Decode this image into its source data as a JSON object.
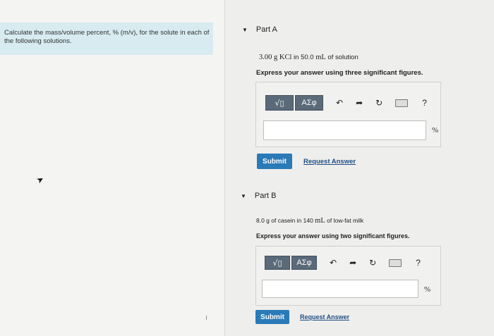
{
  "prompt": "Calculate the mass/volume percent, % (m/v), for the solute in each of the following solutions.",
  "toolbar": {
    "template_icon_label": "√▯",
    "greek_label": "ΑΣφ",
    "undo_icon": "undo-arrow-icon",
    "redo_icon": "redo-arrow-icon",
    "reset_icon": "reset-icon",
    "keyboard_icon": "keyboard-icon",
    "help_label": "?"
  },
  "parts": [
    {
      "header": "Part A",
      "problem_qty": "3.00 g KCl",
      "problem_mid": " in 50.0 ",
      "problem_unit": "mL",
      "problem_tail": " of solution",
      "instruction": "Express your answer using three significant figures.",
      "input_value": "",
      "unit": "%",
      "submit_label": "Submit",
      "request_label": "Request Answer"
    },
    {
      "header": "Part B",
      "problem_qty": "8.0 g",
      "problem_mid": " of casein in 140 ",
      "problem_unit": "mL",
      "problem_tail": " of low-fat milk",
      "instruction": "Express your answer using two significant figures.",
      "input_value": "",
      "unit": "%",
      "submit_label": "Submit",
      "request_label": "Request Answer"
    }
  ]
}
